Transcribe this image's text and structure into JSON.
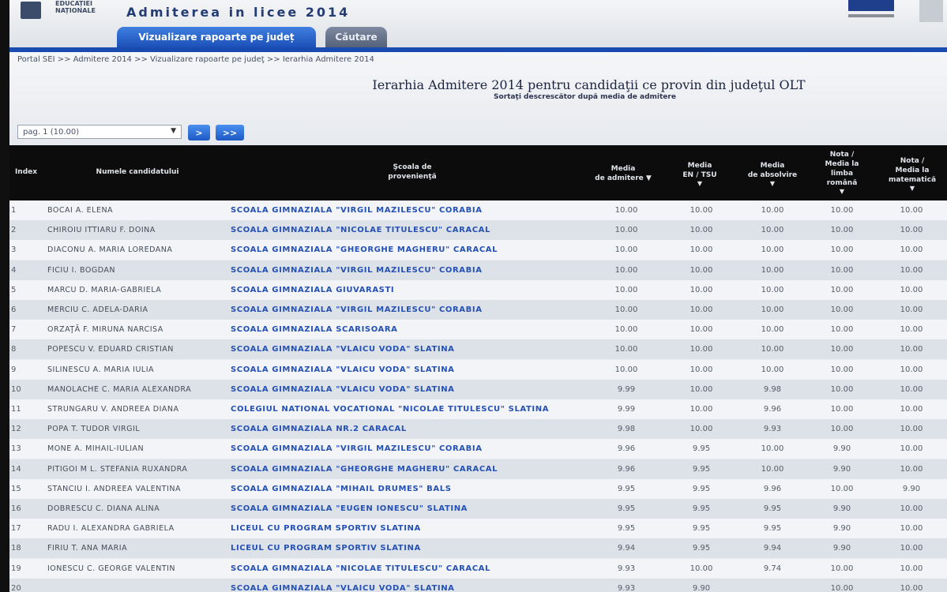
{
  "header": {
    "org_line1": "EDUCAȚIEI",
    "org_line2": "NAȚIONALE",
    "app_title": "Admiterea in licee 2014"
  },
  "tabs": [
    {
      "label": "Vizualizare rapoarte pe județ",
      "active": true
    },
    {
      "label": "Căutare",
      "active": false
    }
  ],
  "breadcrumb": "Portal SEI >> Admitere 2014 >> Vizualizare rapoarte pe judeţ >> Ierarhia Admitere 2014",
  "page": {
    "title": "Ierarhia Admitere 2014 pentru candidaţii ce provin din judeţul OLT",
    "subtitle": "Sortaţi descrescător după media de admitere"
  },
  "pager": {
    "selected": "pag. 1 (10.00)",
    "next_label": ">",
    "last_label": ">>"
  },
  "columns": {
    "index": "Index",
    "name": "Numele candidatului",
    "school_l1": "Şcoala de",
    "school_l2": "provenienţă",
    "adm_l1": "Media",
    "adm_l2": "de admitere",
    "en_l1": "Media",
    "en_l2": "EN / TSU",
    "abs_l1": "Media",
    "abs_l2": "de absolvire",
    "ro_l1": "Nota /",
    "ro_l2": "Media la",
    "ro_l3": "limba",
    "ro_l4": "română",
    "mat_l1": "Nota /",
    "mat_l2": "Media la",
    "mat_l3": "matematică"
  },
  "colors": {
    "tab_active": "#1c50b8",
    "school_link": "#2451b3",
    "header_bg": "#0c0c0c"
  },
  "rows": [
    {
      "index": "1",
      "name": "BOCAI A. ELENA",
      "school": "SCOALA GIMNAZIALA \"VIRGIL MAZILESCU\" CORABIA",
      "adm": "10.00",
      "en": "10.00",
      "abs": "10.00",
      "ro": "10.00",
      "mat": "10.00"
    },
    {
      "index": "2",
      "name": "CHIROIU ITTIARU F. DOINA",
      "school": "SCOALA GIMNAZIALA \"NICOLAE TITULESCU\" CARACAL",
      "adm": "10.00",
      "en": "10.00",
      "abs": "10.00",
      "ro": "10.00",
      "mat": "10.00"
    },
    {
      "index": "3",
      "name": "DIACONU A. MARIA LOREDANA",
      "school": "SCOALA GIMNAZIALA \"GHEORGHE MAGHERU\" CARACAL",
      "adm": "10.00",
      "en": "10.00",
      "abs": "10.00",
      "ro": "10.00",
      "mat": "10.00"
    },
    {
      "index": "4",
      "name": "FICIU I. BOGDAN",
      "school": "SCOALA GIMNAZIALA \"VIRGIL MAZILESCU\" CORABIA",
      "adm": "10.00",
      "en": "10.00",
      "abs": "10.00",
      "ro": "10.00",
      "mat": "10.00"
    },
    {
      "index": "5",
      "name": "MARCU D. MARIA-GABRIELA",
      "school": "SCOALA GIMNAZIALA GIUVARASTI",
      "adm": "10.00",
      "en": "10.00",
      "abs": "10.00",
      "ro": "10.00",
      "mat": "10.00"
    },
    {
      "index": "6",
      "name": "MERCIU C. ADELA-DARIA",
      "school": "SCOALA GIMNAZIALA \"VIRGIL MAZILESCU\" CORABIA",
      "adm": "10.00",
      "en": "10.00",
      "abs": "10.00",
      "ro": "10.00",
      "mat": "10.00"
    },
    {
      "index": "7",
      "name": "ORZAŢĂ F. MIRUNA NARCISA",
      "school": "SCOALA GIMNAZIALA SCARISOARA",
      "adm": "10.00",
      "en": "10.00",
      "abs": "10.00",
      "ro": "10.00",
      "mat": "10.00"
    },
    {
      "index": "8",
      "name": "POPESCU V. EDUARD CRISTIAN",
      "school": "SCOALA GIMNAZIALA \"VLAICU VODA\" SLATINA",
      "adm": "10.00",
      "en": "10.00",
      "abs": "10.00",
      "ro": "10.00",
      "mat": "10.00"
    },
    {
      "index": "9",
      "name": "SILINESCU A. MARIA IULIA",
      "school": "SCOALA GIMNAZIALA \"VLAICU VODA\" SLATINA",
      "adm": "10.00",
      "en": "10.00",
      "abs": "10.00",
      "ro": "10.00",
      "mat": "10.00"
    },
    {
      "index": "10",
      "name": "MANOLACHE C. MARIA ALEXANDRA",
      "school": "SCOALA GIMNAZIALA \"VLAICU VODA\" SLATINA",
      "adm": "9.99",
      "en": "10.00",
      "abs": "9.98",
      "ro": "10.00",
      "mat": "10.00"
    },
    {
      "index": "11",
      "name": "STRUNGARU V. ANDREEA DIANA",
      "school": "COLEGIUL NATIONAL VOCATIONAL \"NICOLAE TITULESCU\" SLATINA",
      "adm": "9.99",
      "en": "10.00",
      "abs": "9.96",
      "ro": "10.00",
      "mat": "10.00"
    },
    {
      "index": "12",
      "name": "POPA T. TUDOR VIRGIL",
      "school": "SCOALA GIMNAZIALA NR.2 CARACAL",
      "adm": "9.98",
      "en": "10.00",
      "abs": "9.93",
      "ro": "10.00",
      "mat": "10.00"
    },
    {
      "index": "13",
      "name": "MONE A. MIHAIL-IULIAN",
      "school": "SCOALA GIMNAZIALA \"VIRGIL MAZILESCU\" CORABIA",
      "adm": "9.96",
      "en": "9.95",
      "abs": "10.00",
      "ro": "9.90",
      "mat": "10.00"
    },
    {
      "index": "14",
      "name": "PITIGOI M L. STEFANIA RUXANDRA",
      "school": "SCOALA GIMNAZIALA \"GHEORGHE MAGHERU\" CARACAL",
      "adm": "9.96",
      "en": "9.95",
      "abs": "10.00",
      "ro": "9.90",
      "mat": "10.00"
    },
    {
      "index": "15",
      "name": "STANCIU I. ANDREEA VALENTINA",
      "school": "SCOALA GIMNAZIALA \"MIHAIL DRUMES\" BALS",
      "adm": "9.95",
      "en": "9.95",
      "abs": "9.96",
      "ro": "10.00",
      "mat": "9.90"
    },
    {
      "index": "16",
      "name": "DOBRESCU C. DIANA ALINA",
      "school": "SCOALA GIMNAZIALA \"EUGEN IONESCU\" SLATINA",
      "adm": "9.95",
      "en": "9.95",
      "abs": "9.95",
      "ro": "9.90",
      "mat": "10.00"
    },
    {
      "index": "17",
      "name": "RADU I. ALEXANDRA GABRIELA",
      "school": "LICEUL CU PROGRAM SPORTIV SLATINA",
      "adm": "9.95",
      "en": "9.95",
      "abs": "9.95",
      "ro": "9.90",
      "mat": "10.00"
    },
    {
      "index": "18",
      "name": "FIRIU T. ANA MARIA",
      "school": "LICEUL CU PROGRAM SPORTIV SLATINA",
      "adm": "9.94",
      "en": "9.95",
      "abs": "9.94",
      "ro": "9.90",
      "mat": "10.00"
    },
    {
      "index": "19",
      "name": "IONESCU C. GEORGE VALENTIN",
      "school": "SCOALA GIMNAZIALA \"NICOLAE TITULESCU\" CARACAL",
      "adm": "9.93",
      "en": "10.00",
      "abs": "9.74",
      "ro": "10.00",
      "mat": "10.00"
    },
    {
      "index": "20",
      "name": "",
      "school": "SCOALA GIMNAZIALA \"VLAICU VODA\" SLATINA",
      "adm": "9.93",
      "en": "9.90",
      "abs": "",
      "ro": "10.00",
      "mat": "10.00"
    }
  ]
}
